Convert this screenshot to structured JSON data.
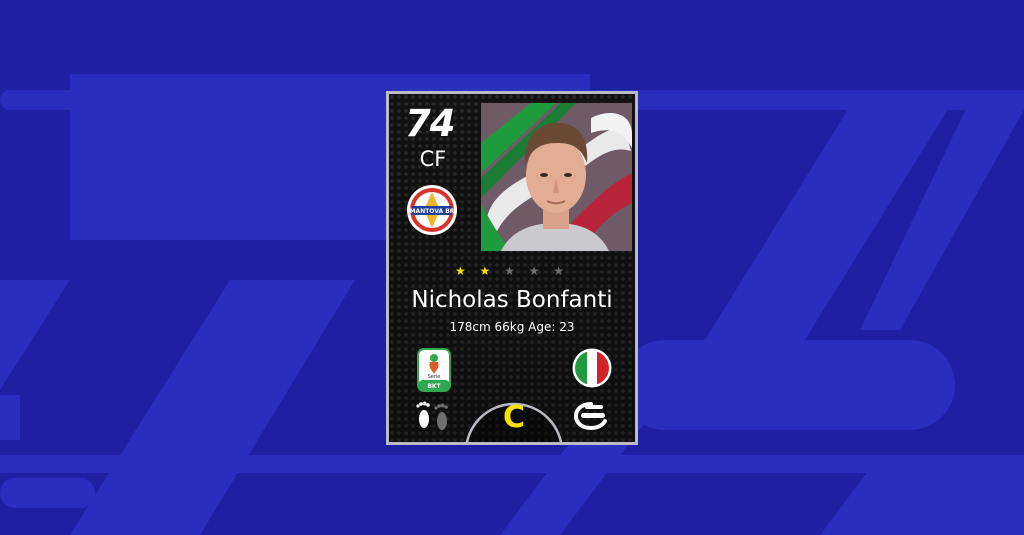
{
  "card": {
    "rating": "74",
    "position": "CF",
    "club": {
      "badge_text": "MANTOVA BR",
      "icon": "club-badge-icon"
    },
    "stars": {
      "filled": 2,
      "total": 5,
      "filled_glyph": "★ ★",
      "empty_glyph": " ★ ★ ★"
    },
    "player_name": "Nicholas Bonfanti",
    "player_info": "178cm 66kg Age: 23",
    "league": {
      "badge_text_1": "Serie",
      "badge_text_2": "BKT",
      "icon": "serie-b-league-icon"
    },
    "nation": {
      "icon": "italy-flag-icon",
      "colors": [
        "#1e9b3c",
        "#ffffff",
        "#d2232a"
      ]
    },
    "grade": "C",
    "brand": {
      "icon": "efootball-logo-icon"
    }
  },
  "colors": {
    "background": "#1f1fa3",
    "background_shape": "#2a2dbd",
    "card_border": "#b9bcc4",
    "star_filled": "#f4e300",
    "grade": "#f4e300"
  }
}
